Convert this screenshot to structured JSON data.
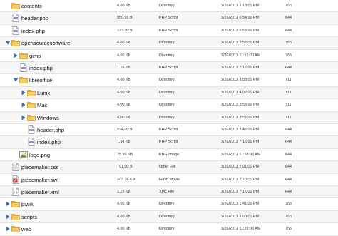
{
  "rows": [
    {
      "level": 0,
      "toggle": "none",
      "icon": "folder-icon",
      "name": "contents",
      "size": "4.00 KB",
      "type": "Directory",
      "date": "3/26/2013 2:13:00 PM",
      "perm": "755"
    },
    {
      "level": 0,
      "toggle": "none",
      "icon": "php-file-icon",
      "name": "header.php",
      "size": "950.00 B",
      "type": "PHP Script",
      "date": "3/26/2013 6:54:00 PM",
      "perm": "644"
    },
    {
      "level": 0,
      "toggle": "none",
      "icon": "php-file-icon",
      "name": "index.php",
      "size": "223.00 B",
      "type": "PHP Script",
      "date": "3/26/2013 6:58:00 PM",
      "perm": "644"
    },
    {
      "level": 0,
      "toggle": "expanded",
      "icon": "folder-icon",
      "name": "opensourcesoftware",
      "size": "4.00 KB",
      "type": "Directory",
      "date": "3/26/2013 3:58:00 PM",
      "perm": "755"
    },
    {
      "level": 1,
      "toggle": "collapsed",
      "icon": "folder-icon",
      "name": "gimp",
      "size": "4.00 KB",
      "type": "Directory",
      "date": "3/26/2013 11:51:00 AM",
      "perm": "755"
    },
    {
      "level": 1,
      "toggle": "none",
      "icon": "php-file-icon",
      "name": "index.php",
      "size": "1.26 KB",
      "type": "PHP Script",
      "date": "3/26/2013 7:16:00 PM",
      "perm": "644"
    },
    {
      "level": 1,
      "toggle": "expanded",
      "icon": "folder-icon",
      "name": "libreoffice",
      "size": "4.00 KB",
      "type": "Directory",
      "date": "3/26/2013 3:58:00 PM",
      "perm": "711"
    },
    {
      "level": 2,
      "toggle": "collapsed",
      "icon": "folder-icon",
      "name": "Lunix",
      "size": "4.00 KB",
      "type": "Directory",
      "date": "3/26/2013 4:02:00 PM",
      "perm": "711"
    },
    {
      "level": 2,
      "toggle": "collapsed",
      "icon": "folder-icon",
      "name": "Mac",
      "size": "4.00 KB",
      "type": "Directory",
      "date": "3/26/2013 3:58:00 PM",
      "perm": "711"
    },
    {
      "level": 2,
      "toggle": "collapsed",
      "icon": "folder-icon",
      "name": "Windows",
      "size": "4.00 KB",
      "type": "Directory",
      "date": "3/26/2013 3:58:00 PM",
      "perm": "711"
    },
    {
      "level": 2,
      "toggle": "none",
      "icon": "php-file-icon",
      "name": "header.php",
      "size": "924.00 B",
      "type": "PHP Script",
      "date": "3/26/2013 3:48:00 PM",
      "perm": "644"
    },
    {
      "level": 2,
      "toggle": "none",
      "icon": "php-file-icon",
      "name": "index.php",
      "size": "1.54 KB",
      "type": "PHP Script",
      "date": "3/26/2013 7:16:00 PM",
      "perm": "644"
    },
    {
      "level": 1,
      "toggle": "none",
      "icon": "image-file-icon",
      "name": "logo.png",
      "size": "75.90 KB",
      "type": "PNG Image",
      "date": "3/26/2013 11:58:00 AM",
      "perm": "644"
    },
    {
      "level": 0,
      "toggle": "none",
      "icon": "css-file-icon",
      "name": "piecemaker.css",
      "size": "791.00 B",
      "type": "Other File",
      "date": "3/26/2013 7:01:00 PM",
      "perm": "644"
    },
    {
      "level": 0,
      "toggle": "none",
      "icon": "flash-file-icon",
      "name": "piecemaker.swf",
      "size": "203.26 KB",
      "type": "Flash Movie",
      "date": "3/26/2013 2:10:00 PM",
      "perm": "644"
    },
    {
      "level": 0,
      "toggle": "none",
      "icon": "xml-file-icon",
      "name": "piecemaker.xml",
      "size": "2.25 KB",
      "type": "XML File",
      "date": "3/26/2013 7:16:00 PM",
      "perm": "644"
    },
    {
      "level": 0,
      "toggle": "collapsed",
      "icon": "folder-icon",
      "name": "piwik",
      "size": "4.00 KB",
      "type": "Directory",
      "date": "3/26/2013 1:41:00 PM",
      "perm": "755"
    },
    {
      "level": 0,
      "toggle": "collapsed",
      "icon": "folder-icon",
      "name": "scripts",
      "size": "4.00 KB",
      "type": "Directory",
      "date": "3/26/2013 2:00:00 PM",
      "perm": "755"
    },
    {
      "level": 0,
      "toggle": "collapsed",
      "icon": "folder-icon",
      "name": "web",
      "size": "4.00 KB",
      "type": "Directory",
      "date": "3/26/2013 11:29:00 AM",
      "perm": "755"
    }
  ],
  "colors": {
    "folder": "#e8b84a",
    "folder_dark": "#c8962a",
    "toggle": "#2f73b8"
  }
}
